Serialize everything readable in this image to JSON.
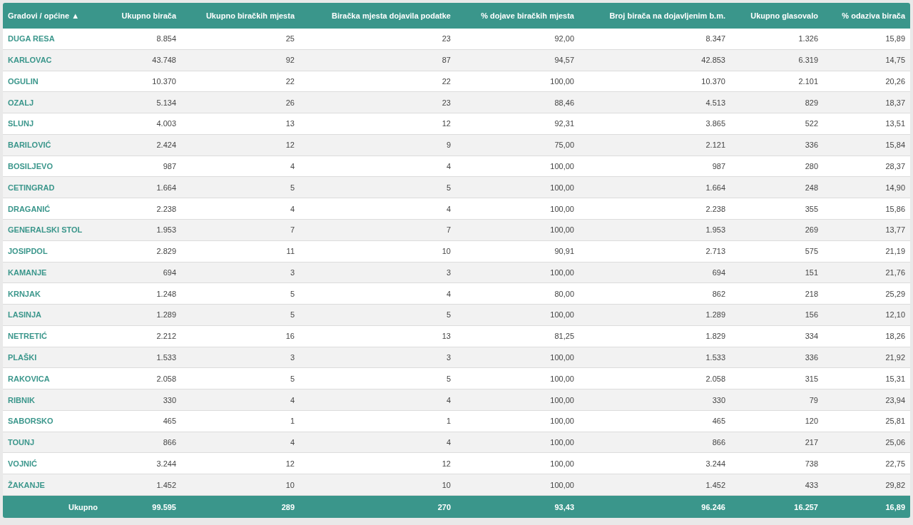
{
  "table": {
    "columns": [
      "Gradovi / općine ▲",
      "Ukupno birača",
      "Ukupno biračkih mjesta",
      "Biračka mjesta dojavila podatke",
      "% dojave biračkih mjesta",
      "Broj birača na dojavljenim b.m.",
      "Ukupno glasovalo",
      "% odaziva birača"
    ],
    "rows": [
      [
        "DUGA RESA",
        "8.854",
        "25",
        "23",
        "92,00",
        "8.347",
        "1.326",
        "15,89"
      ],
      [
        "KARLOVAC",
        "43.748",
        "92",
        "87",
        "94,57",
        "42.853",
        "6.319",
        "14,75"
      ],
      [
        "OGULIN",
        "10.370",
        "22",
        "22",
        "100,00",
        "10.370",
        "2.101",
        "20,26"
      ],
      [
        "OZALJ",
        "5.134",
        "26",
        "23",
        "88,46",
        "4.513",
        "829",
        "18,37"
      ],
      [
        "SLUNJ",
        "4.003",
        "13",
        "12",
        "92,31",
        "3.865",
        "522",
        "13,51"
      ],
      [
        "BARILOVIĆ",
        "2.424",
        "12",
        "9",
        "75,00",
        "2.121",
        "336",
        "15,84"
      ],
      [
        "BOSILJEVO",
        "987",
        "4",
        "4",
        "100,00",
        "987",
        "280",
        "28,37"
      ],
      [
        "CETINGRAD",
        "1.664",
        "5",
        "5",
        "100,00",
        "1.664",
        "248",
        "14,90"
      ],
      [
        "DRAGANIĆ",
        "2.238",
        "4",
        "4",
        "100,00",
        "2.238",
        "355",
        "15,86"
      ],
      [
        "GENERALSKI STOL",
        "1.953",
        "7",
        "7",
        "100,00",
        "1.953",
        "269",
        "13,77"
      ],
      [
        "JOSIPDOL",
        "2.829",
        "11",
        "10",
        "90,91",
        "2.713",
        "575",
        "21,19"
      ],
      [
        "KAMANJE",
        "694",
        "3",
        "3",
        "100,00",
        "694",
        "151",
        "21,76"
      ],
      [
        "KRNJAK",
        "1.248",
        "5",
        "4",
        "80,00",
        "862",
        "218",
        "25,29"
      ],
      [
        "LASINJA",
        "1.289",
        "5",
        "5",
        "100,00",
        "1.289",
        "156",
        "12,10"
      ],
      [
        "NETRETIĆ",
        "2.212",
        "16",
        "13",
        "81,25",
        "1.829",
        "334",
        "18,26"
      ],
      [
        "PLAŠKI",
        "1.533",
        "3",
        "3",
        "100,00",
        "1.533",
        "336",
        "21,92"
      ],
      [
        "RAKOVICA",
        "2.058",
        "5",
        "5",
        "100,00",
        "2.058",
        "315",
        "15,31"
      ],
      [
        "RIBNIK",
        "330",
        "4",
        "4",
        "100,00",
        "330",
        "79",
        "23,94"
      ],
      [
        "SABORSKO",
        "465",
        "1",
        "1",
        "100,00",
        "465",
        "120",
        "25,81"
      ],
      [
        "TOUNJ",
        "866",
        "4",
        "4",
        "100,00",
        "866",
        "217",
        "25,06"
      ],
      [
        "VOJNIĆ",
        "3.244",
        "12",
        "12",
        "100,00",
        "3.244",
        "738",
        "22,75"
      ],
      [
        "ŽAKANJE",
        "1.452",
        "10",
        "10",
        "100,00",
        "1.452",
        "433",
        "29,82"
      ]
    ],
    "total": [
      "Ukupno",
      "99.595",
      "289",
      "270",
      "93,43",
      "96.246",
      "16.257",
      "16,89"
    ]
  }
}
